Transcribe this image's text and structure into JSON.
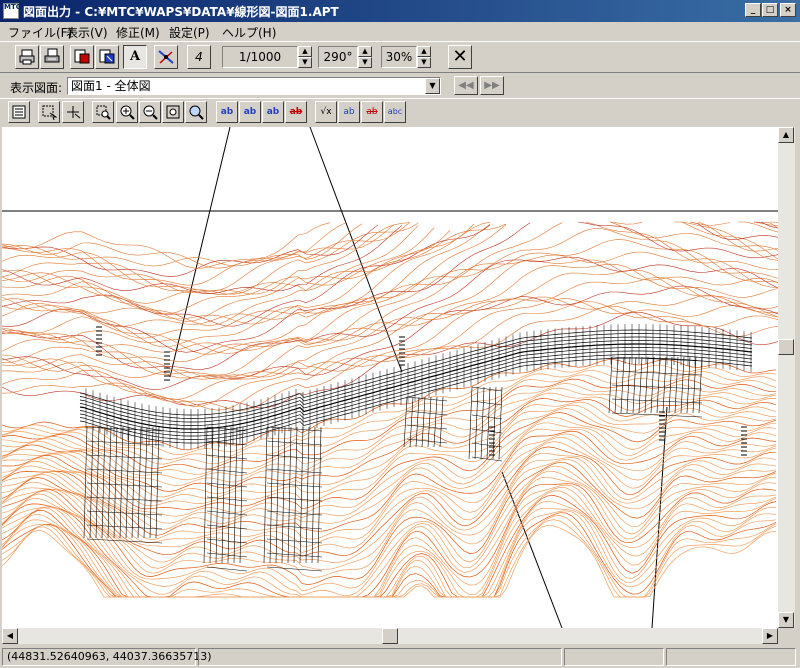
{
  "window": {
    "title": "図面出力 - C:¥MTC¥WAPS¥DATA¥線形図-図面1.APT",
    "app_icon_text": "MTC",
    "controls": {
      "minimize": "_",
      "maximize": "□",
      "close": "×"
    }
  },
  "menu": [
    {
      "label": "ファイル(F)"
    },
    {
      "label": "表示(V)"
    },
    {
      "label": "修正(M)"
    },
    {
      "label": "設定(P)"
    },
    {
      "label": "ヘルプ(H)"
    }
  ],
  "toolbar": {
    "scale_value": "1/1000",
    "angle_value": "290°",
    "zoom_value": "30%",
    "text_button": "A",
    "close_glyph": "✕",
    "page_glyph": "4"
  },
  "drawing_selector": {
    "label": "表示図面:",
    "selected": "図面1 - 全体図",
    "prev": "◀◀",
    "next": "▶▶"
  },
  "view_toolbar": {
    "b1": "ab",
    "b2": "ab",
    "b3": "ab",
    "b4": "ab",
    "b5": "√x",
    "b6": "ab",
    "b7": "ab",
    "b8": "abc"
  },
  "status": {
    "coordinates": "(44831.52640963, 44037.36635713)"
  }
}
